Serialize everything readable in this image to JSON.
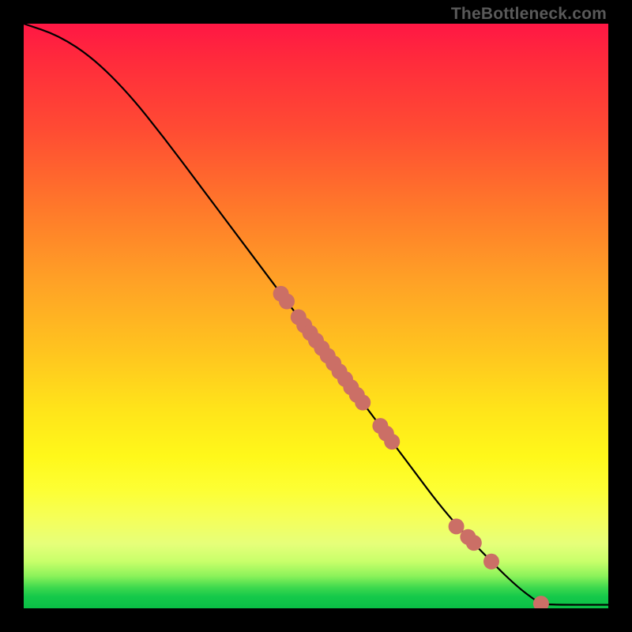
{
  "watermark": "TheBottleneck.com",
  "colors": {
    "point_fill": "#cb6f66",
    "point_stroke": "#995048",
    "line": "#000000",
    "background": "#000000"
  },
  "chart_data": {
    "type": "line",
    "title": "",
    "xlabel": "",
    "ylabel": "",
    "xlim": [
      0,
      100
    ],
    "ylim": [
      0,
      100
    ],
    "grid": false,
    "legend": false,
    "curve": [
      {
        "x": 0,
        "y": 100
      },
      {
        "x": 6,
        "y": 98
      },
      {
        "x": 12,
        "y": 94
      },
      {
        "x": 18,
        "y": 88
      },
      {
        "x": 24,
        "y": 80.5
      },
      {
        "x": 30,
        "y": 72.5
      },
      {
        "x": 36,
        "y": 64.5
      },
      {
        "x": 42,
        "y": 56.5
      },
      {
        "x": 48,
        "y": 48.5
      },
      {
        "x": 54,
        "y": 40.5
      },
      {
        "x": 60,
        "y": 32.5
      },
      {
        "x": 66,
        "y": 24.5
      },
      {
        "x": 72,
        "y": 16.5
      },
      {
        "x": 78,
        "y": 10
      },
      {
        "x": 84,
        "y": 4
      },
      {
        "x": 88,
        "y": 1
      },
      {
        "x": 89,
        "y": 0.6
      },
      {
        "x": 100,
        "y": 0.6
      }
    ],
    "points": [
      {
        "x": 44,
        "y": 53.8
      },
      {
        "x": 45,
        "y": 52.5
      },
      {
        "x": 47,
        "y": 49.8
      },
      {
        "x": 48,
        "y": 48.4
      },
      {
        "x": 49,
        "y": 47.1
      },
      {
        "x": 50,
        "y": 45.8
      },
      {
        "x": 51,
        "y": 44.5
      },
      {
        "x": 52,
        "y": 43.2
      },
      {
        "x": 53,
        "y": 41.9
      },
      {
        "x": 54,
        "y": 40.5
      },
      {
        "x": 55,
        "y": 39.2
      },
      {
        "x": 56,
        "y": 37.8
      },
      {
        "x": 57,
        "y": 36.5
      },
      {
        "x": 58,
        "y": 35.2
      },
      {
        "x": 61,
        "y": 31.2
      },
      {
        "x": 62,
        "y": 29.9
      },
      {
        "x": 63,
        "y": 28.5
      },
      {
        "x": 74,
        "y": 14.0
      },
      {
        "x": 76,
        "y": 12.2
      },
      {
        "x": 77,
        "y": 11.2
      },
      {
        "x": 80,
        "y": 8.0
      },
      {
        "x": 88.5,
        "y": 0.8
      }
    ]
  }
}
